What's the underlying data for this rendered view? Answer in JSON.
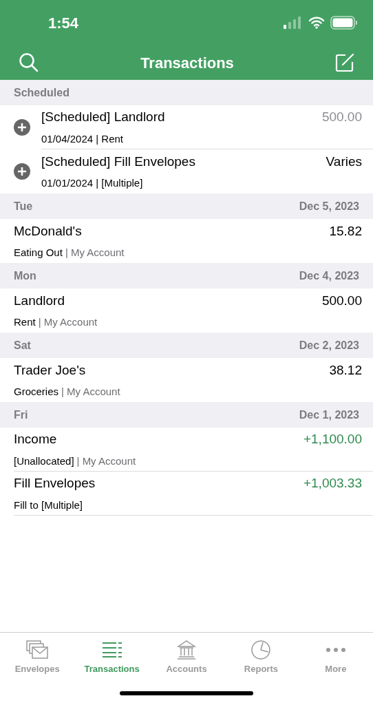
{
  "status_bar": {
    "time": "1:54"
  },
  "nav": {
    "title": "Transactions"
  },
  "sections": [
    {
      "label": "Scheduled",
      "rows": [
        {
          "kind": "scheduled",
          "title": "[Scheduled] Landlord",
          "amount": "500.00",
          "color": "#8e8e93",
          "category": "01/04/2024 | Rent"
        },
        {
          "kind": "scheduled",
          "title": "[Scheduled] Fill Envelopes",
          "amount": "Varies",
          "color": "#000000",
          "category": "01/01/2024 | [Multiple]"
        }
      ]
    },
    {
      "label": "Tue",
      "date": "Dec 5, 2023",
      "rows": [
        {
          "kind": "normal",
          "title": "McDonald's",
          "amount": "15.82",
          "color": "#000000",
          "category": "Eating Out",
          "account": "| My Account"
        }
      ]
    },
    {
      "label": "Mon",
      "date": "Dec 4, 2023",
      "rows": [
        {
          "kind": "normal",
          "title": "Landlord",
          "amount": "500.00",
          "color": "#000000",
          "category": "Rent",
          "account": "| My Account"
        }
      ]
    },
    {
      "label": "Sat",
      "date": "Dec 2, 2023",
      "rows": [
        {
          "kind": "normal",
          "title": "Trader Joe's",
          "amount": "38.12",
          "color": "#000000",
          "category": "Groceries",
          "account": "| My Account"
        }
      ]
    },
    {
      "label": "Fri",
      "date": "Dec 1, 2023",
      "rows": [
        {
          "kind": "normal",
          "title": "Income",
          "amount": "+1,100.00",
          "color": "#2e8b4e",
          "category": "[Unallocated]",
          "account": "| My Account"
        },
        {
          "kind": "normal",
          "title": "Fill Envelopes",
          "amount": "+1,003.33",
          "color": "#2e8b4e",
          "category": "Fill to [Multiple]"
        }
      ]
    }
  ],
  "tabs": [
    {
      "kind": "envelopes",
      "label": "Envelopes",
      "selected": false
    },
    {
      "kind": "transactions",
      "label": "Transactions",
      "selected": true
    },
    {
      "kind": "accounts",
      "label": "Accounts",
      "selected": false
    },
    {
      "kind": "reports",
      "label": "Reports",
      "selected": false
    },
    {
      "kind": "more",
      "label": "More",
      "selected": false
    }
  ]
}
